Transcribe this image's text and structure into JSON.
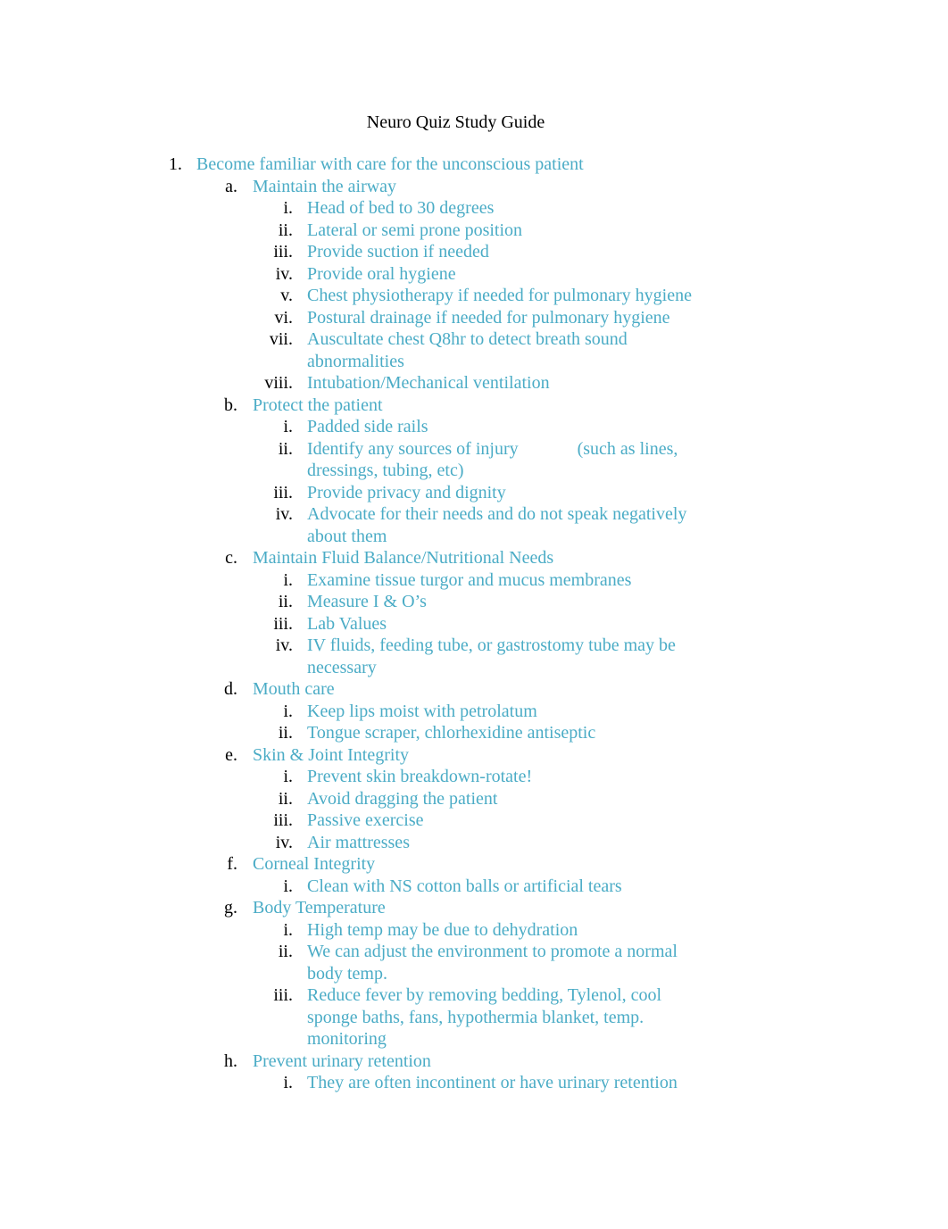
{
  "document": {
    "title": "Neuro Quiz Study Guide",
    "accent_color": "#4BACC6",
    "sections": [
      {
        "marker": "1.",
        "text": "Become familiar with care for the unconscious patient",
        "items": [
          {
            "marker": "a.",
            "text": "Maintain the airway",
            "items": [
              {
                "marker": "i.",
                "text": "Head of bed to 30 degrees"
              },
              {
                "marker": "ii.",
                "text": "Lateral or semi prone position"
              },
              {
                "marker": "iii.",
                "text": "Provide suction if needed"
              },
              {
                "marker": "iv.",
                "text": "Provide oral hygiene"
              },
              {
                "marker": "v.",
                "text": "Chest physiotherapy if needed for pulmonary hygiene"
              },
              {
                "marker": "vi.",
                "text": "Postural drainage if needed for pulmonary hygiene"
              },
              {
                "marker": "vii.",
                "text": "Auscultate chest Q8hr to detect breath sound abnormalities"
              },
              {
                "marker": "viii.",
                "text": "Intubation/Mechanical ventilation"
              }
            ]
          },
          {
            "marker": "b.",
            "text": "Protect the patient",
            "items": [
              {
                "marker": "i.",
                "text": "Padded side rails"
              },
              {
                "marker": "ii.",
                "text": "Identify any sources of injury",
                "text2": "(such as lines, dressings, tubing, etc)"
              },
              {
                "marker": "iii.",
                "text": "Provide privacy and dignity"
              },
              {
                "marker": "iv.",
                "text": "Advocate for their needs and do not speak negatively about them"
              }
            ]
          },
          {
            "marker": "c.",
            "text": "Maintain Fluid Balance/Nutritional Needs",
            "items": [
              {
                "marker": "i.",
                "text": "Examine tissue turgor and mucus membranes"
              },
              {
                "marker": "ii.",
                "text": "Measure I & O’s"
              },
              {
                "marker": "iii.",
                "text": "Lab Values"
              },
              {
                "marker": "iv.",
                "text": "IV fluids, feeding tube, or gastrostomy tube may be necessary"
              }
            ]
          },
          {
            "marker": "d.",
            "text": "Mouth care",
            "items": [
              {
                "marker": "i.",
                "text": "Keep lips moist with petrolatum"
              },
              {
                "marker": "ii.",
                "text": "Tongue scraper, chlorhexidine antiseptic"
              }
            ]
          },
          {
            "marker": "e.",
            "text": "Skin & Joint Integrity",
            "items": [
              {
                "marker": "i.",
                "text": "Prevent skin breakdown-rotate!"
              },
              {
                "marker": "ii.",
                "text": "Avoid dragging the patient"
              },
              {
                "marker": "iii.",
                "text": "Passive exercise"
              },
              {
                "marker": "iv.",
                "text": "Air mattresses"
              }
            ]
          },
          {
            "marker": "f.",
            "text": "Corneal Integrity",
            "items": [
              {
                "marker": "i.",
                "text": "Clean with NS cotton balls or artificial tears"
              }
            ]
          },
          {
            "marker": "g.",
            "text": "Body Temperature",
            "items": [
              {
                "marker": "i.",
                "text": "High temp may be due to dehydration"
              },
              {
                "marker": "ii.",
                "text": "We can adjust the environment to promote a normal body temp."
              },
              {
                "marker": "iii.",
                "text": "Reduce fever by removing bedding, Tylenol, cool sponge baths, fans, hypothermia blanket, temp. monitoring"
              }
            ]
          },
          {
            "marker": "h.",
            "text": "Prevent urinary retention",
            "items": [
              {
                "marker": "i.",
                "text": "They are often incontinent or have urinary retention"
              }
            ]
          }
        ]
      }
    ]
  }
}
